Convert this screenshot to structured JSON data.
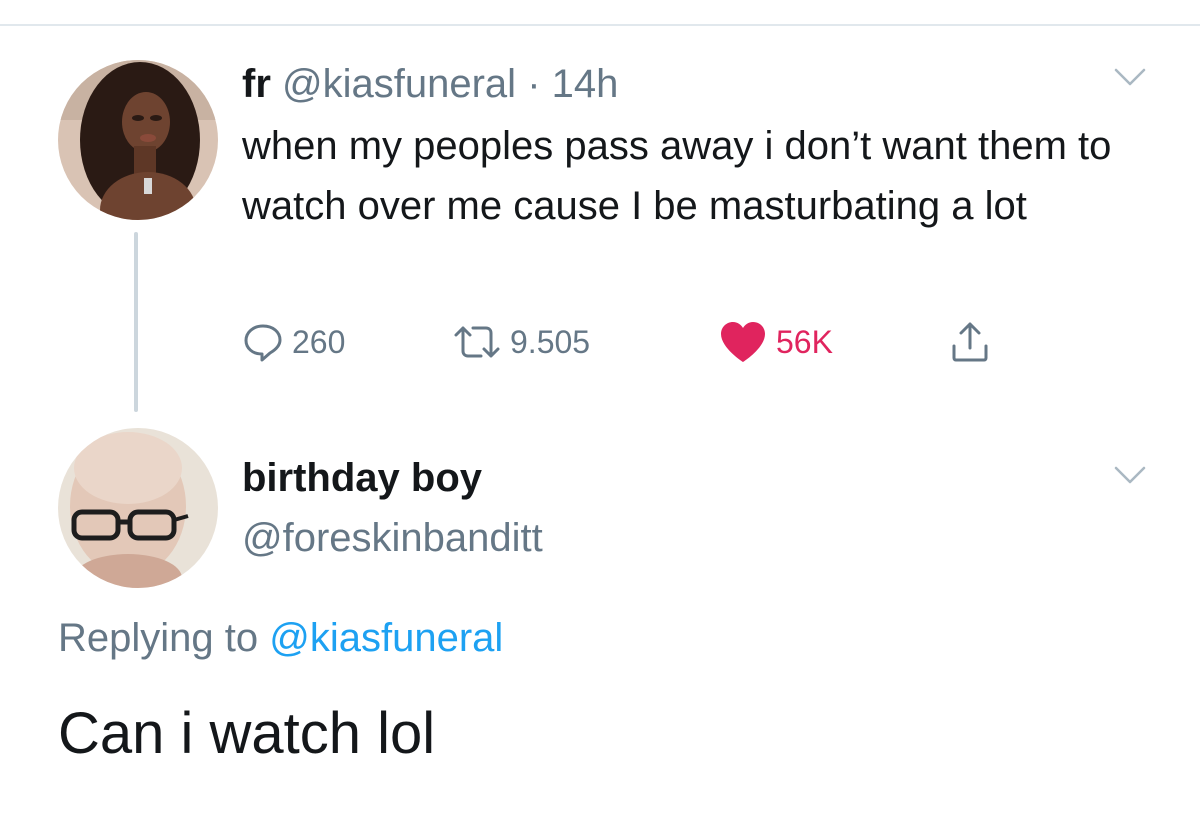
{
  "tweet": {
    "author_name": "fr",
    "author_handle": "@kiasfuneral",
    "separator": "·",
    "time": "14h",
    "text": "when my peoples pass away i don’t want them to watch over me cause I be masturbating a lot",
    "replies": "260",
    "retweets": "9.505",
    "likes": "56K",
    "liked": true,
    "avatar_icon": "user-avatar-photo"
  },
  "reply": {
    "author_name": "birthday boy",
    "author_handle": "@foreskinbanditt",
    "replying_prefix": "Replying to",
    "replying_mention": "@kiasfuneral",
    "text": "Can i watch lol",
    "avatar_icon": "user-avatar-photo"
  },
  "colors": {
    "primary_text": "#14171a",
    "secondary_text": "#657786",
    "mention": "#1da1f2",
    "like": "#e0245e",
    "divider": "#e1e8ed"
  }
}
